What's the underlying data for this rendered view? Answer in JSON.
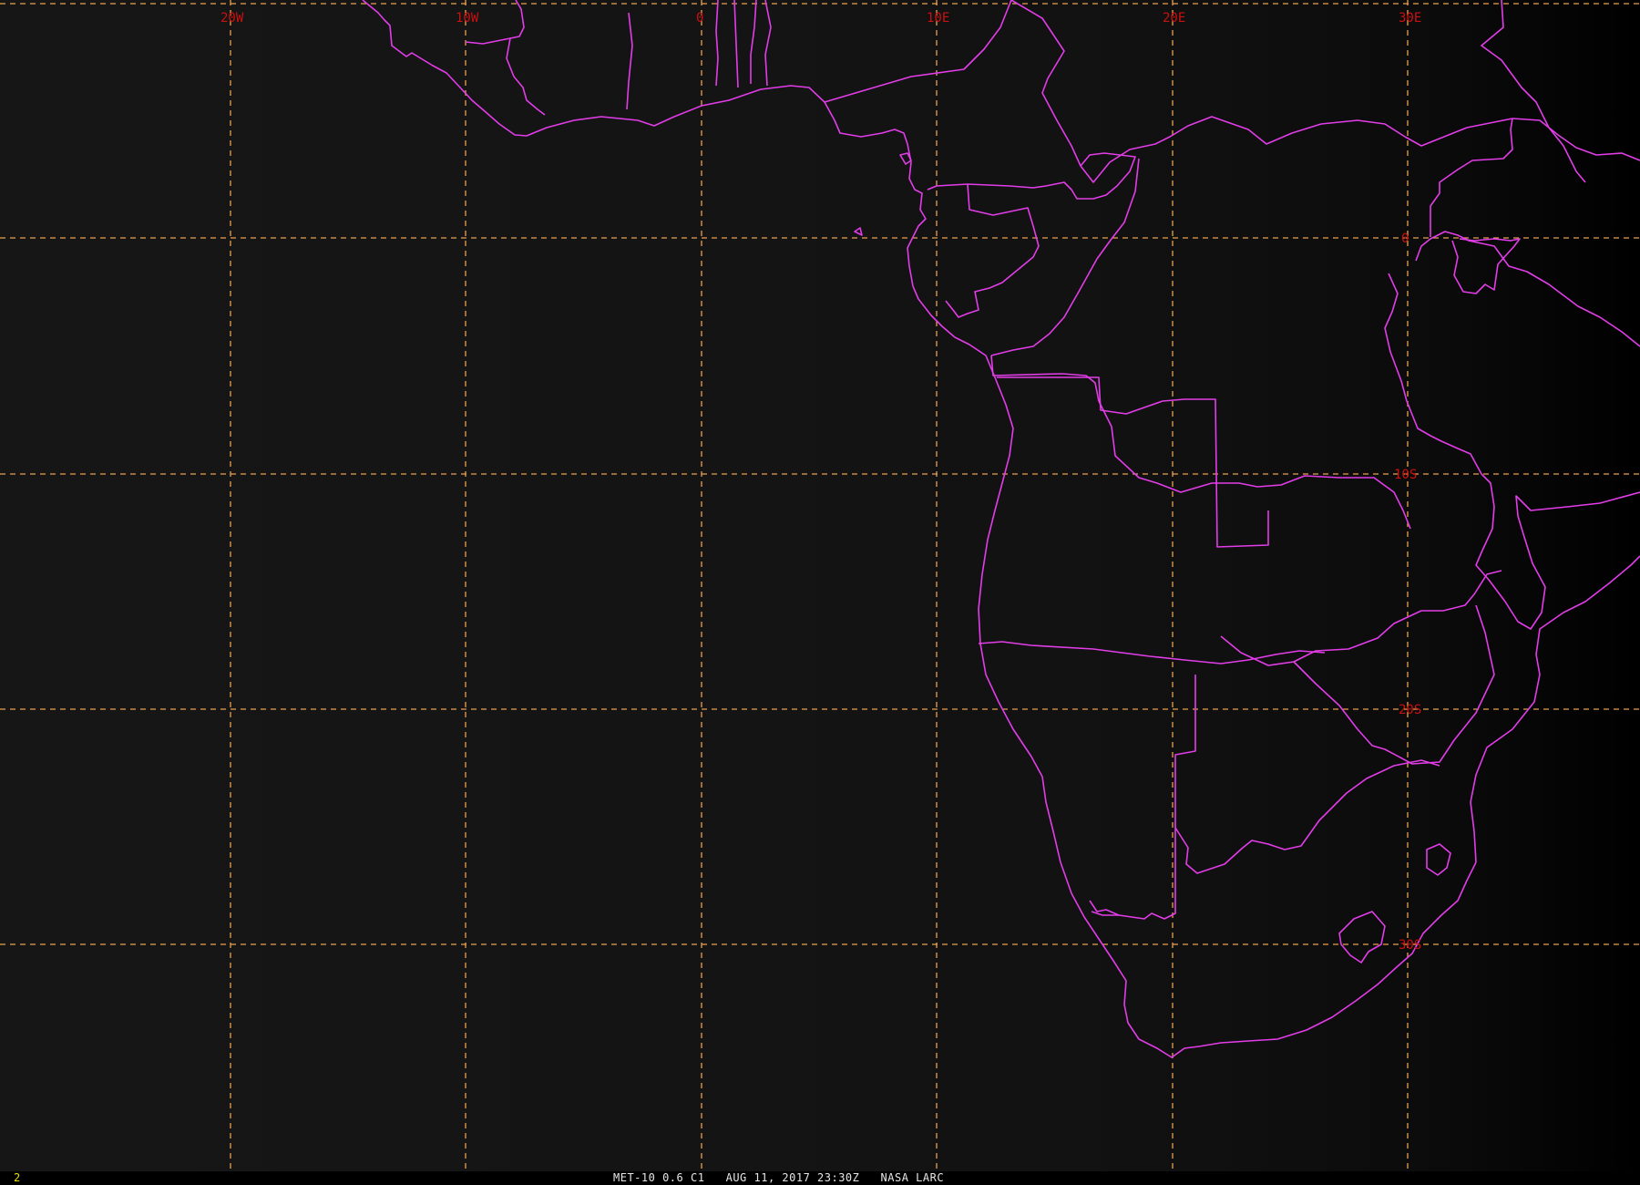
{
  "map": {
    "frame_number": "2",
    "caption": "MET-10 0.6 C1   AUG 11, 2017 23:30Z   NASA LARC",
    "colors": {
      "grid": "#e8a050",
      "borders": "#e23de8",
      "grid_labels": "#cc1010",
      "frame_number": "#e8e000"
    },
    "longitude_labels": [
      "20W",
      "10W",
      "0",
      "10E",
      "20E",
      "30E"
    ],
    "latitude_labels": [
      "0",
      "10S",
      "20S",
      "30S"
    ]
  }
}
